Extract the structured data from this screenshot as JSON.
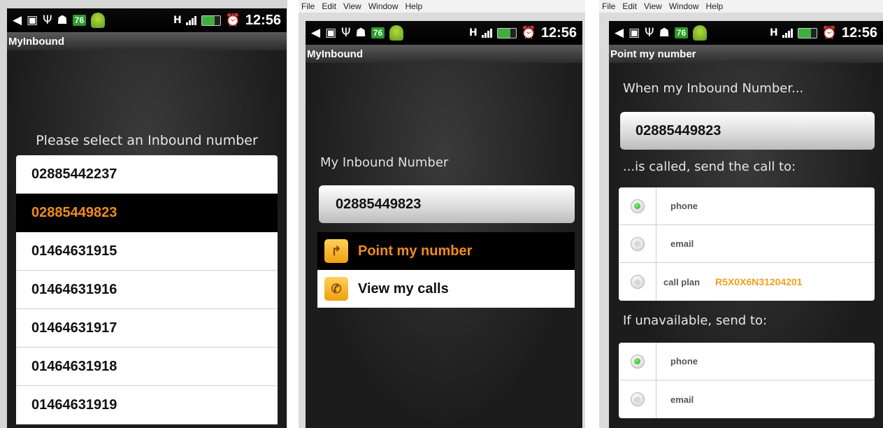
{
  "status_bar": {
    "battery_level": "76",
    "time": "12:56",
    "signal_label": "H"
  },
  "screen1": {
    "app_title": "MyInbound",
    "prompt": "Please select an Inbound number",
    "numbers": [
      "02885442237",
      "02885449823",
      "01464631915",
      "01464631916",
      "01464631917",
      "01464631918",
      "01464631919"
    ],
    "selected_index": 1
  },
  "screen2": {
    "window_menu": [
      "File",
      "Edit",
      "View",
      "Window",
      "Help"
    ],
    "app_title": "MyInbound",
    "label": "My Inbound Number",
    "number": "02885449823",
    "menu": [
      {
        "label": "Point my number",
        "icon": "arrow-icon",
        "selected": true
      },
      {
        "label": "View my calls",
        "icon": "phone-icon",
        "selected": false
      }
    ]
  },
  "screen3": {
    "window_menu": [
      "File",
      "Edit",
      "View",
      "Window",
      "Help"
    ],
    "title": "Point my number",
    "when_text": "When my Inbound Number...",
    "number": "02885449823",
    "called_text": "...is called, send the call to:",
    "options": [
      {
        "label": "phone",
        "selected": true
      },
      {
        "label": "email",
        "selected": false
      },
      {
        "label": "call plan",
        "selected": false,
        "value": "R5X0X6N31204201"
      }
    ],
    "unavailable_text": "If unavailable, send to:",
    "unavailable_options": [
      {
        "label": "phone",
        "selected": true
      },
      {
        "label": "email",
        "selected": false
      }
    ]
  },
  "colors": {
    "accent_orange": "#f08c1c",
    "radio_green": "#1eaa1e"
  }
}
